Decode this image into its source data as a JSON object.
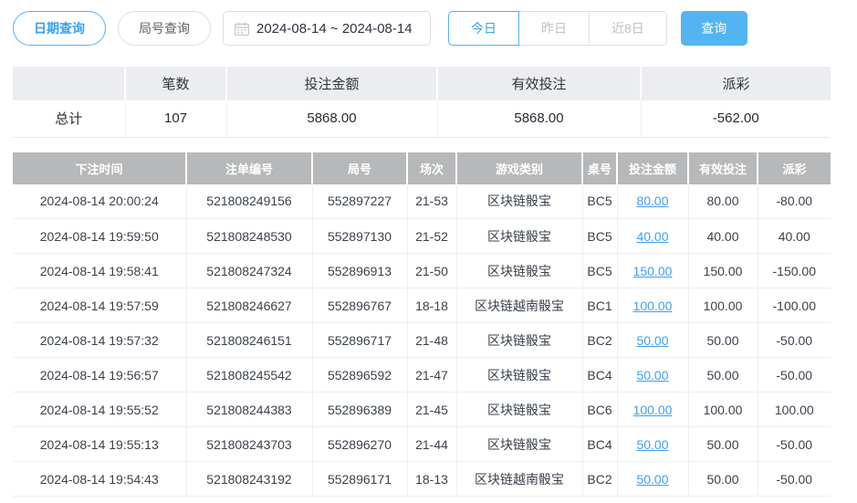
{
  "toolbar": {
    "date_query_label": "日期查询",
    "round_query_label": "局号查询",
    "date_range_value": "2024-08-14 ~ 2024-08-14",
    "today_label": "今日",
    "yesterday_label": "昨日",
    "last8_label": "近8日",
    "search_label": "查询"
  },
  "summary": {
    "headers": [
      "",
      "笔数",
      "投注金额",
      "有效投注",
      "派彩"
    ],
    "total_label": "总计",
    "count": "107",
    "bet_amount": "5868.00",
    "valid_bet": "5868.00",
    "payout": "-562.00"
  },
  "table": {
    "headers": [
      "下注时间",
      "注单编号",
      "局号",
      "场次",
      "游戏类别",
      "桌号",
      "投注金额",
      "有效投注",
      "派彩"
    ],
    "rows": [
      {
        "time": "2024-08-14 20:00:24",
        "order_no": "521808249156",
        "round_no": "552897227",
        "session": "21-53",
        "game": "区块链骰宝",
        "table_no": "BC5",
        "bet": "80.00",
        "valid": "80.00",
        "payout": "-80.00"
      },
      {
        "time": "2024-08-14 19:59:50",
        "order_no": "521808248530",
        "round_no": "552897130",
        "session": "21-52",
        "game": "区块链骰宝",
        "table_no": "BC5",
        "bet": "40.00",
        "valid": "40.00",
        "payout": "40.00"
      },
      {
        "time": "2024-08-14 19:58:41",
        "order_no": "521808247324",
        "round_no": "552896913",
        "session": "21-50",
        "game": "区块链骰宝",
        "table_no": "BC5",
        "bet": "150.00",
        "valid": "150.00",
        "payout": "-150.00"
      },
      {
        "time": "2024-08-14 19:57:59",
        "order_no": "521808246627",
        "round_no": "552896767",
        "session": "18-18",
        "game": "区块链越南骰宝",
        "table_no": "BC1",
        "bet": "100.00",
        "valid": "100.00",
        "payout": "-100.00"
      },
      {
        "time": "2024-08-14 19:57:32",
        "order_no": "521808246151",
        "round_no": "552896717",
        "session": "21-48",
        "game": "区块链骰宝",
        "table_no": "BC2",
        "bet": "50.00",
        "valid": "50.00",
        "payout": "-50.00"
      },
      {
        "time": "2024-08-14 19:56:57",
        "order_no": "521808245542",
        "round_no": "552896592",
        "session": "21-47",
        "game": "区块链骰宝",
        "table_no": "BC4",
        "bet": "50.00",
        "valid": "50.00",
        "payout": "-50.00"
      },
      {
        "time": "2024-08-14 19:55:52",
        "order_no": "521808244383",
        "round_no": "552896389",
        "session": "21-45",
        "game": "区块链骰宝",
        "table_no": "BC6",
        "bet": "100.00",
        "valid": "100.00",
        "payout": "100.00"
      },
      {
        "time": "2024-08-14 19:55:13",
        "order_no": "521808243703",
        "round_no": "552896270",
        "session": "21-44",
        "game": "区块链骰宝",
        "table_no": "BC4",
        "bet": "50.00",
        "valid": "50.00",
        "payout": "-50.00"
      },
      {
        "time": "2024-08-14 19:54:43",
        "order_no": "521808243192",
        "round_no": "552896171",
        "session": "18-13",
        "game": "区块链越南骰宝",
        "table_no": "BC2",
        "bet": "50.00",
        "valid": "50.00",
        "payout": "-50.00"
      }
    ]
  },
  "colors": {
    "accent_blue": "#54b4f1",
    "link_blue": "#3da0f2",
    "negative_red": "#f2566b",
    "table_header_gray": "#b6b8ba",
    "summary_header_gray": "#ebedf0"
  }
}
